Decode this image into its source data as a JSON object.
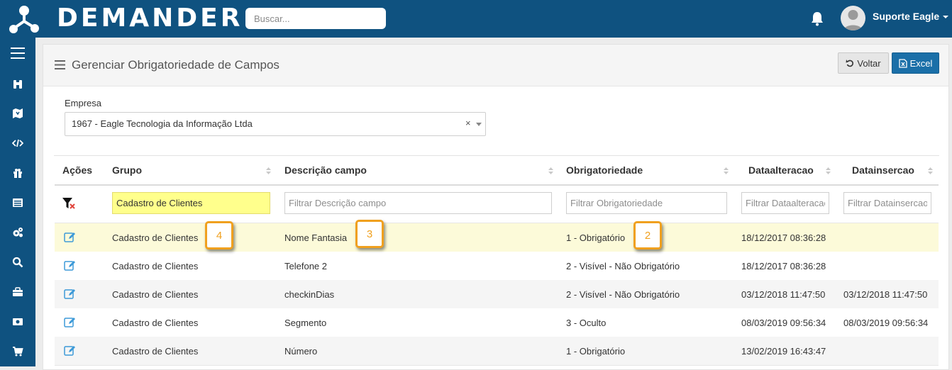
{
  "app": {
    "logo_text": "DEMANDER",
    "search_placeholder": "Buscar...",
    "user_name": "Suporte Eagle"
  },
  "sidebar": {
    "items": [
      "menu-icon",
      "binoculars-icon",
      "map-icon",
      "code-icon",
      "gift-icon",
      "list-icon",
      "cogs-icon",
      "search-icon",
      "briefcase-icon",
      "money-icon",
      "cart-icon"
    ]
  },
  "page": {
    "title": "Gerenciar Obrigatoriedade de Campos",
    "back_label": "Voltar",
    "excel_label": "Excel"
  },
  "empresa": {
    "label": "Empresa",
    "value": "1967 - Eagle Tecnologia da Informação Ltda",
    "clear": "×"
  },
  "table": {
    "headers": [
      "Ações",
      "Grupo",
      "Descrição campo",
      "Obrigatoriedade",
      "Dataalteracao",
      "Datainsercao"
    ],
    "filters": {
      "grupo_value": "Cadastro de Clientes",
      "descricao_placeholder": "Filtrar Descrição campo",
      "obrig_placeholder": "Filtrar Obrigatoriedade",
      "dataalt_placeholder": "Filtrar Dataalteracao",
      "datains_placeholder": "Filtrar Datainsercao"
    },
    "rows": [
      {
        "grupo": "Cadastro de Clientes",
        "descricao": "Nome Fantasia",
        "obrigatoriedade": "1 - Obrigatório",
        "dataalteracao": "18/12/2017 08:36:28",
        "datainsercao": ""
      },
      {
        "grupo": "Cadastro de Clientes",
        "descricao": "Telefone 2",
        "obrigatoriedade": "2 - Visível - Não Obrigatório",
        "dataalteracao": "18/12/2017 08:36:28",
        "datainsercao": ""
      },
      {
        "grupo": "Cadastro de Clientes",
        "descricao": "checkinDias",
        "obrigatoriedade": "2 - Visível - Não Obrigatório",
        "dataalteracao": "03/12/2018 11:47:50",
        "datainsercao": "03/12/2018 11:47:50"
      },
      {
        "grupo": "Cadastro de Clientes",
        "descricao": "Segmento",
        "obrigatoriedade": "3 - Oculto",
        "dataalteracao": "08/03/2019 09:56:34",
        "datainsercao": "08/03/2019 09:56:34"
      },
      {
        "grupo": "Cadastro de Clientes",
        "descricao": "Número",
        "obrigatoriedade": "1 - Obrigatório",
        "dataalteracao": "13/02/2019 16:43:47",
        "datainsercao": ""
      }
    ]
  },
  "annotations": [
    "4",
    "3",
    "2"
  ],
  "colors": {
    "brand": "#0f5280",
    "excel": "#1a6fa8",
    "badge": "#f0a01e",
    "highlight_row": "#fcfad9",
    "filter_highlight": "#ffff8c"
  }
}
